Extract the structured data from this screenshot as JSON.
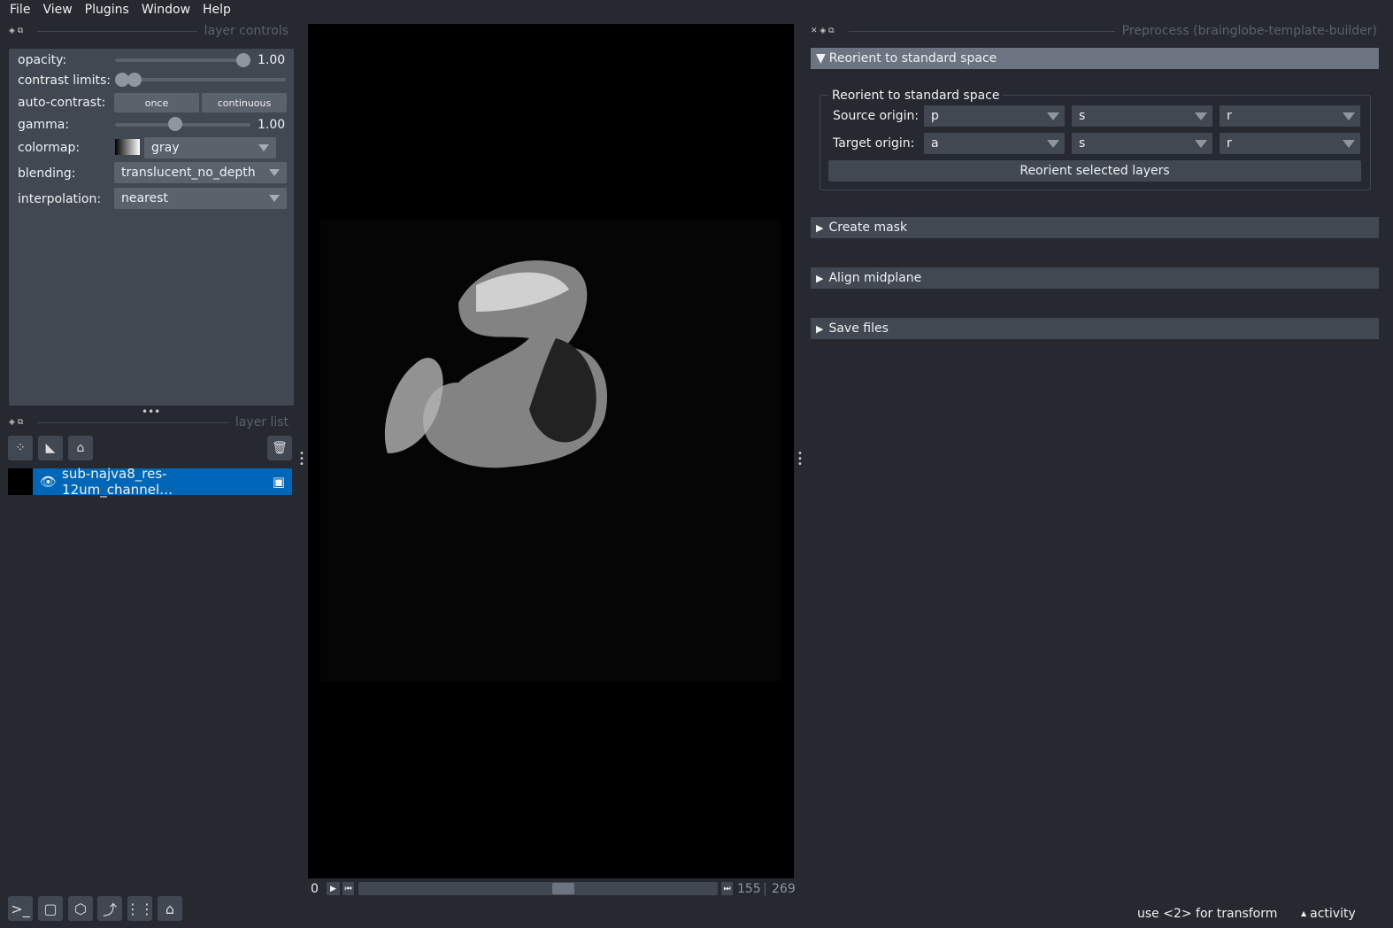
{
  "menu": [
    "File",
    "View",
    "Plugins",
    "Window",
    "Help"
  ],
  "layer_controls": {
    "title": "layer controls",
    "opacity_label": "opacity:",
    "opacity": "1.00",
    "contrast_label": "contrast limits:",
    "contrast_limits_fraction": [
      0.0,
      0.05
    ],
    "autocontrast_label": "auto-contrast:",
    "once": "once",
    "continuous": "continuous",
    "gamma_label": "gamma:",
    "gamma": "1.00",
    "colormap_label": "colormap:",
    "colormap": "gray",
    "blending_label": "blending:",
    "blending": "translucent_no_depth",
    "interpolation_label": "interpolation:",
    "interpolation": "nearest"
  },
  "layer_list": {
    "title": "layer list",
    "layers": [
      {
        "name": "sub-najva8_res-12um_channel…",
        "visible": true,
        "selected": true
      }
    ]
  },
  "dims": {
    "axis": "0",
    "current": "155",
    "total": "269"
  },
  "plugin": {
    "title": "Preprocess (brainglobe-template-builder)",
    "sections": [
      {
        "label": "Reorient to standard space",
        "expanded": true
      },
      {
        "label": "Create mask",
        "expanded": false
      },
      {
        "label": "Align midplane",
        "expanded": false
      },
      {
        "label": "Save files",
        "expanded": false
      }
    ],
    "group_title": "Reorient to standard space",
    "source_label": "Source origin:",
    "source": [
      "p",
      "s",
      "r"
    ],
    "target_label": "Target origin:",
    "target": [
      "a",
      "s",
      "r"
    ],
    "reorient_button": "Reorient selected layers"
  },
  "status": {
    "hint": "use <2> for transform",
    "activity": "activity"
  },
  "colors": {
    "background": "#262930",
    "panel": "#414851",
    "accent": "#0067b8",
    "header": "#6b7480"
  }
}
